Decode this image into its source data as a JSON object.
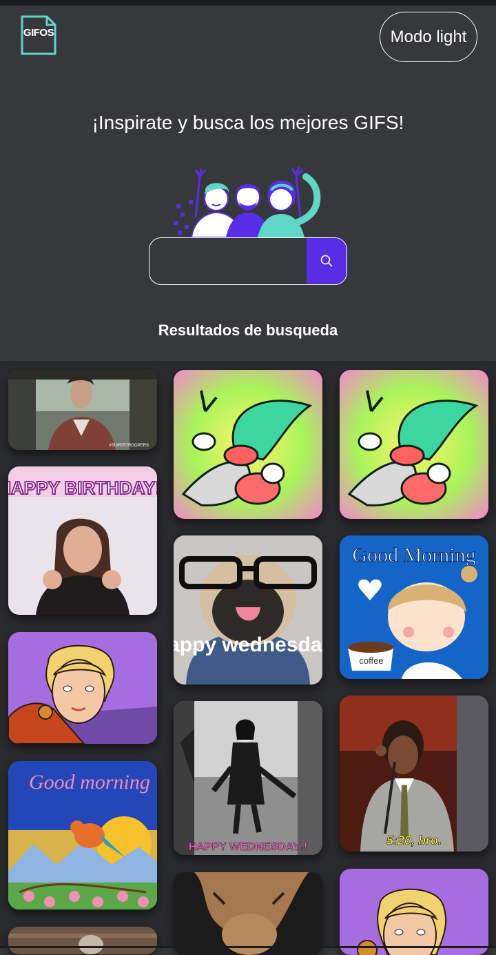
{
  "header": {
    "logo_text": "GIFOS",
    "mode_button_label": "Modo light"
  },
  "hero": {
    "title": "¡Inspirate y busca los mejores GIFS!"
  },
  "search": {
    "value": "",
    "placeholder": "",
    "button_icon": "search-icon"
  },
  "results": {
    "title": "Resultados de busqueda",
    "gifs": [
      {
        "caption": "#SUPERTROOPERS"
      },
      {
        "caption": "HAPPY BIRTHDAY!!"
      },
      {
        "caption": ""
      },
      {
        "caption": "Good morning"
      },
      {
        "caption": ""
      },
      {
        "caption": ""
      },
      {
        "caption": "happy wednesday!"
      },
      {
        "caption": "HAPPY WEDNESDAY!!"
      },
      {
        "caption": ""
      },
      {
        "caption": ""
      },
      {
        "caption": "Good Morning"
      },
      {
        "caption": "coffee"
      },
      {
        "caption": "5:20, bro."
      },
      {
        "caption": ""
      }
    ]
  },
  "colors": {
    "background": "#37383c",
    "grid_background": "#2a2b2e",
    "accent": "#572ee5",
    "logo_teal": "#5ed7c6"
  }
}
